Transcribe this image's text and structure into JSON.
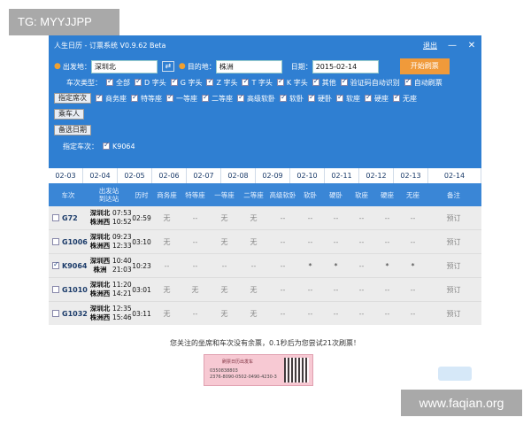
{
  "watermarks": {
    "top": "TG: MYYJJPP",
    "bottom": "www.faqian.org"
  },
  "window": {
    "title": "人生日历 - 订票系统 V0.9.62 Beta",
    "logout": "退出",
    "minimize": "—",
    "close": "✕"
  },
  "form": {
    "from_label": "出发地：",
    "from_value": "深圳北",
    "to_label": "目的地：",
    "to_value": "株洲",
    "date_label": "日期：",
    "date_value": "2015-02-14",
    "start_button": "开始刷票",
    "train_type_label": "车次类型：",
    "train_types": [
      "全部",
      "D 字头",
      "G 字头",
      "Z 字头",
      "T 字头",
      "K 字头",
      "其他"
    ],
    "extra_options": [
      "验证码自动识别",
      "自动刷票"
    ],
    "seat_button": "指定席次",
    "seats": [
      "商务座",
      "特等座",
      "一等座",
      "二等座",
      "高级软卧",
      "软卧",
      "硬卧",
      "软座",
      "硬座",
      "无座"
    ],
    "passenger_button": "乘车人",
    "backup_date_button": "备选日期",
    "train_label": "指定车次：",
    "train_value": "K9064"
  },
  "tabs": [
    "02-03",
    "02-04",
    "02-05",
    "02-06",
    "02-07",
    "02-08",
    "02-09",
    "02-10",
    "02-11",
    "02-12",
    "02-13",
    "02-14"
  ],
  "columns": [
    "车次",
    "出发站\n到达站",
    "历时",
    "商务座",
    "特等座",
    "一等座",
    "二等座",
    "高级软卧",
    "软卧",
    "硬卧",
    "软座",
    "硬座",
    "无座",
    "备注"
  ],
  "rows": [
    {
      "code": "G72",
      "checked": false,
      "stations": [
        "深圳北",
        "株洲西"
      ],
      "times": [
        "07:53",
        "10:52"
      ],
      "duration": "02:59",
      "cells": [
        "无",
        "--",
        "无",
        "无",
        "--",
        "--",
        "--",
        "--",
        "--",
        "--",
        "预订"
      ]
    },
    {
      "code": "G1006",
      "checked": false,
      "stations": [
        "深圳北",
        "株洲西"
      ],
      "times": [
        "09:23",
        "12:33"
      ],
      "duration": "03:10",
      "cells": [
        "无",
        "--",
        "无",
        "无",
        "--",
        "--",
        "--",
        "--",
        "--",
        "--",
        "预订"
      ]
    },
    {
      "code": "K9064",
      "checked": true,
      "stations": [
        "深圳西",
        "株洲"
      ],
      "times": [
        "10:40",
        "21:03"
      ],
      "duration": "10:23",
      "cells": [
        "--",
        "--",
        "--",
        "--",
        "--",
        "*",
        "*",
        "--",
        "*",
        "*",
        "预订"
      ]
    },
    {
      "code": "G1010",
      "checked": false,
      "stations": [
        "深圳北",
        "株洲西"
      ],
      "times": [
        "11:20",
        "14:21"
      ],
      "duration": "03:01",
      "cells": [
        "无",
        "无",
        "无",
        "无",
        "--",
        "--",
        "--",
        "--",
        "--",
        "--",
        "预订"
      ]
    },
    {
      "code": "G1032",
      "checked": false,
      "stations": [
        "深圳北",
        "株洲西"
      ],
      "times": [
        "12:35",
        "15:46"
      ],
      "duration": "03:11",
      "cells": [
        "无",
        "--",
        "无",
        "无",
        "--",
        "--",
        "--",
        "--",
        "--",
        "--",
        "预订"
      ]
    }
  ],
  "popup": {
    "message": "您关注的坐席和车次没有余票，0.1秒后为您尝试21次刷票！",
    "ticket_line1": "刷票日历出发车",
    "ticket_line2": "0350838803",
    "ticket_line3": "2376-8090-0502-0490-4230-3"
  }
}
